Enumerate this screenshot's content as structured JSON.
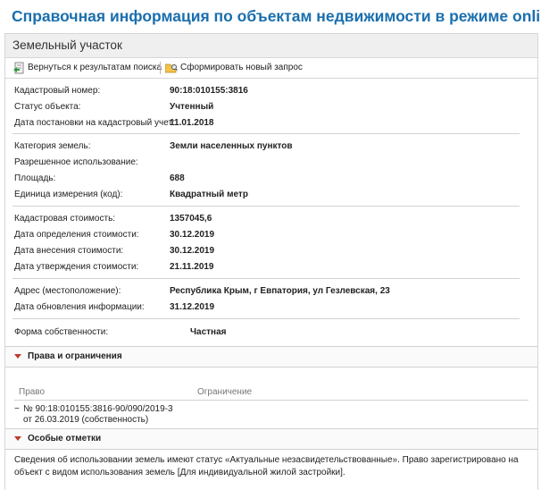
{
  "page_title": "Справочная информация по объектам недвижимости в режиме online",
  "panel_title": "Земельный участок",
  "toolbar": {
    "back_label": "Вернуться к результатам поиска",
    "new_query_label": "Сформировать новый запрос"
  },
  "info": {
    "group1": [
      {
        "key": "Кадастровый номер:",
        "value": "90:18:010155:3816"
      },
      {
        "key": "Статус объекта:",
        "value": "Учтенный"
      },
      {
        "key": "Дата постановки на кадастровый учет:",
        "value": "11.01.2018"
      }
    ],
    "group2": [
      {
        "key": "Категория земель:",
        "value": "Земли населенных пунктов"
      },
      {
        "key": "Разрешенное использование:",
        "value": ""
      },
      {
        "key": "Площадь:",
        "value": "688"
      },
      {
        "key": "Единица измерения (код):",
        "value": "Квадратный метр"
      }
    ],
    "group3": [
      {
        "key": "Кадастровая стоимость:",
        "value": "1357045,6"
      },
      {
        "key": "Дата определения стоимости:",
        "value": "30.12.2019"
      },
      {
        "key": "Дата внесения стоимости:",
        "value": "30.12.2019"
      },
      {
        "key": "Дата утверждения стоимости:",
        "value": "21.11.2019"
      }
    ],
    "group4": [
      {
        "key": "Адрес (местоположение):",
        "value": "Республика Крым, г Евпатория, ул Гезлевская, 23"
      },
      {
        "key": "Дата обновления информации:",
        "value": "31.12.2019"
      }
    ]
  },
  "ownership": {
    "key": "Форма собственности:",
    "value": "Частная"
  },
  "rights_section": {
    "title": "Права и ограничения",
    "col_right": "Право",
    "col_restriction": "Ограничение",
    "row": {
      "line1": "№ 90:18:010155:3816-90/090/2019-3",
      "line2": "от 26.03.2019  (собственность)"
    }
  },
  "notes_section": {
    "title": "Особые отметки",
    "text": "Сведения об использовании земель имеют статус «Актуальные незасвидетельствованные». Право зарегистрировано на объект с видом использования земель [Для индивидуальной жилой застройки]."
  },
  "icons": {
    "back": "back-arrow-document-icon",
    "new_query": "folder-search-icon",
    "collapse": "triangle-down-icon"
  },
  "colors": {
    "title_blue": "#1a6fae",
    "triangle_red": "#c0392b"
  }
}
